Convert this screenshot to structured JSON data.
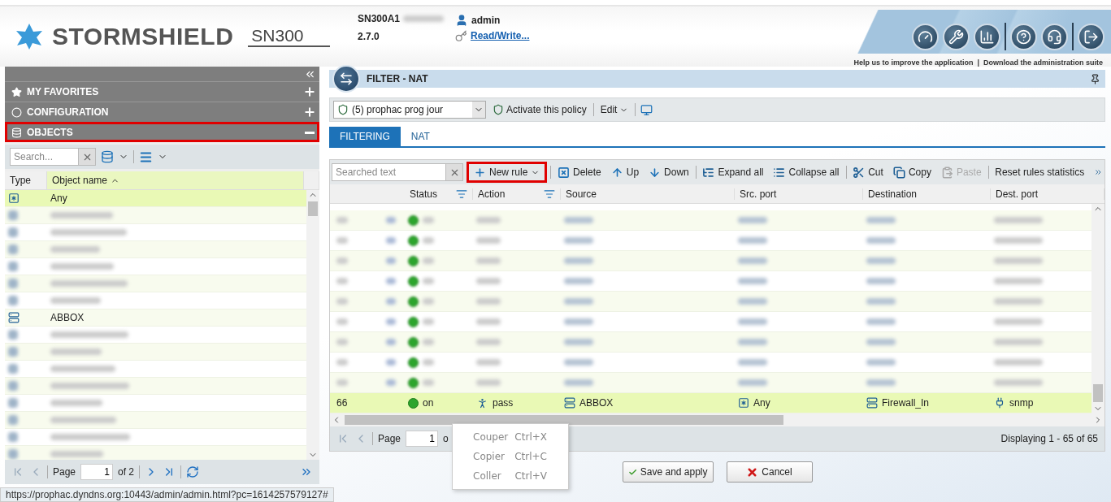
{
  "header": {
    "brand": "STORMSHIELD",
    "model": "SN300",
    "serial": "SN300A1",
    "version": "2.7.0",
    "user": "admin",
    "access": "Read/Write...",
    "tools": [
      {
        "kind": "gauge"
      },
      {
        "kind": "tools"
      },
      {
        "kind": "chart"
      },
      {
        "kind": "help"
      },
      {
        "kind": "support"
      },
      {
        "kind": "logout"
      }
    ],
    "links": [
      "Help us to improve the application",
      "Download the administration suite"
    ],
    "link_separator": "|"
  },
  "sidebar": {
    "sections": [
      {
        "label": "MY FAVORITES",
        "kind": "star",
        "expanded": false,
        "highlighted": false
      },
      {
        "label": "CONFIGURATION",
        "kind": "circle",
        "expanded": false,
        "highlighted": false
      },
      {
        "label": "OBJECTS",
        "kind": "database",
        "expanded": true,
        "highlighted": true
      }
    ],
    "search_placeholder": "Search...",
    "columns": [
      "Type",
      "Object name"
    ],
    "rows": [
      {
        "kind": "any",
        "name": "Any",
        "selected": true
      },
      {
        "kind": "blurred",
        "selected": false
      },
      {
        "kind": "blurred",
        "selected": false
      },
      {
        "kind": "blurred",
        "selected": false
      },
      {
        "kind": "blurred",
        "selected": false
      },
      {
        "kind": "blurred",
        "selected": false
      },
      {
        "kind": "blurred",
        "selected": false
      },
      {
        "kind": "host",
        "name": "ABBOX",
        "selected": false
      },
      {
        "kind": "blurred",
        "selected": false
      },
      {
        "kind": "blurred",
        "selected": false
      },
      {
        "kind": "blurred",
        "selected": false
      },
      {
        "kind": "blurred",
        "selected": false
      },
      {
        "kind": "blurred",
        "selected": false
      },
      {
        "kind": "blurred",
        "selected": false
      },
      {
        "kind": "blurred",
        "selected": false
      },
      {
        "kind": "blurred",
        "selected": false
      }
    ],
    "pager": {
      "page_label": "Page",
      "page": "1",
      "of": "of 2"
    }
  },
  "status_url": "https://prophac.dyndns.org:10443/admin/admin.html?pc=1614257579127#",
  "filter": {
    "title": "FILTER - NAT",
    "policy": "(5) prophac prog jour",
    "activate": "Activate this policy",
    "edit": "Edit",
    "tabs": [
      {
        "label": "FILTERING",
        "selected": true
      },
      {
        "label": "NAT",
        "selected": false
      }
    ],
    "search_placeholder": "Searched text",
    "toolbar": [
      {
        "kind": "plus",
        "label": "New rule",
        "dropdown": true,
        "highlighted": true,
        "disabled": false
      },
      {
        "kind": "delete",
        "label": "Delete",
        "dropdown": false,
        "highlighted": false,
        "disabled": false
      },
      {
        "kind": "up",
        "label": "Up",
        "dropdown": false,
        "highlighted": false,
        "disabled": false
      },
      {
        "kind": "down",
        "label": "Down",
        "dropdown": false,
        "highlighted": false,
        "disabled": false
      },
      {
        "kind": "expand",
        "label": "Expand all",
        "dropdown": false,
        "highlighted": false,
        "disabled": false
      },
      {
        "kind": "collapse",
        "label": "Collapse all",
        "dropdown": false,
        "highlighted": false,
        "disabled": false
      },
      {
        "kind": "cut",
        "label": "Cut",
        "dropdown": false,
        "highlighted": false,
        "disabled": false
      },
      {
        "kind": "copy",
        "label": "Copy",
        "dropdown": false,
        "highlighted": false,
        "disabled": false
      },
      {
        "kind": "paste",
        "label": "Paste",
        "dropdown": false,
        "highlighted": false,
        "disabled": true
      },
      {
        "kind": "text",
        "label": "Reset rules statistics",
        "dropdown": false,
        "highlighted": false,
        "disabled": false
      }
    ],
    "columns": [
      {
        "label": "Status",
        "menu": true
      },
      {
        "label": "Action",
        "menu": true
      },
      {
        "label": "Source",
        "menu": false
      },
      {
        "label": "Src. port",
        "menu": false
      },
      {
        "label": "Destination",
        "menu": false
      },
      {
        "label": "Dest. port",
        "menu": false
      }
    ],
    "rows": [
      {
        "kind": "blurred",
        "enabled": true
      },
      {
        "kind": "blurred",
        "enabled": true
      },
      {
        "kind": "blurred",
        "enabled": true
      },
      {
        "kind": "blurred",
        "enabled": true
      },
      {
        "kind": "blurred",
        "enabled": true
      },
      {
        "kind": "blurred",
        "enabled": true
      },
      {
        "kind": "blurred",
        "enabled": true
      },
      {
        "kind": "blurred",
        "enabled": true
      },
      {
        "kind": "blurred",
        "enabled": true
      },
      {
        "kind": "rule",
        "number": "66",
        "enabled": true,
        "status": "on",
        "action": "pass",
        "source": "ABBOX",
        "src_port": "Any",
        "destination": "Firewall_In",
        "dest_port": "snmp",
        "selected": true
      }
    ],
    "pager": {
      "page_label": "Page",
      "page": "1",
      "of": "o"
    },
    "displaying": "Displaying 1 - 65 of 65"
  },
  "context_menu": [
    {
      "label": "Couper",
      "shortcut": "Ctrl+X",
      "disabled": true
    },
    {
      "label": "Copier",
      "shortcut": "Ctrl+C",
      "disabled": true
    },
    {
      "label": "Coller",
      "shortcut": "Ctrl+V",
      "disabled": true
    }
  ],
  "actions": [
    {
      "kind": "save",
      "label": "Save and apply"
    },
    {
      "kind": "cancel",
      "label": "Cancel"
    }
  ]
}
